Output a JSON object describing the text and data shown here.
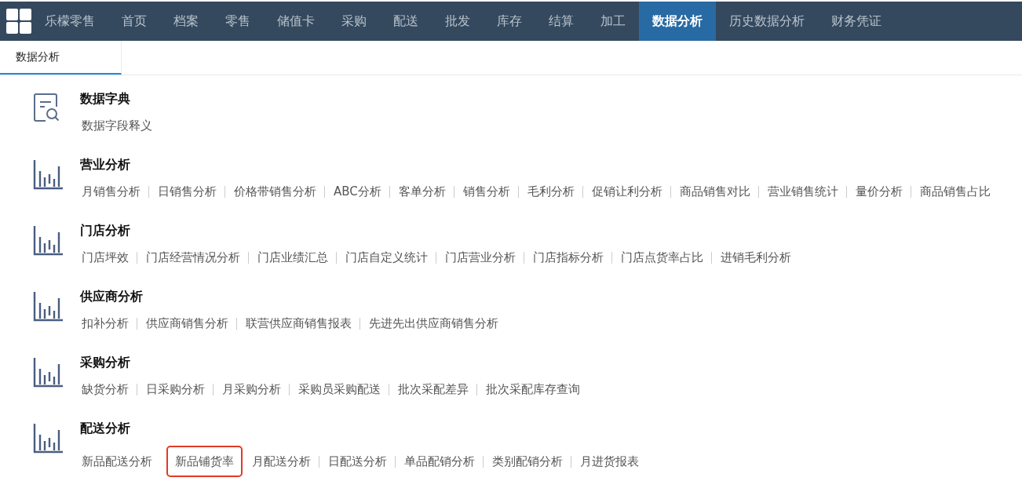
{
  "nav": {
    "brand": "乐檬零售",
    "items": [
      {
        "label": "首页",
        "selected": false
      },
      {
        "label": "档案",
        "selected": false
      },
      {
        "label": "零售",
        "selected": false
      },
      {
        "label": "储值卡",
        "selected": false
      },
      {
        "label": "采购",
        "selected": false
      },
      {
        "label": "配送",
        "selected": false
      },
      {
        "label": "批发",
        "selected": false
      },
      {
        "label": "库存",
        "selected": false
      },
      {
        "label": "结算",
        "selected": false
      },
      {
        "label": "加工",
        "selected": false
      },
      {
        "label": "数据分析",
        "selected": true
      },
      {
        "label": "历史数据分析",
        "selected": false
      },
      {
        "label": "财务凭证",
        "selected": false
      }
    ]
  },
  "tabs": [
    {
      "label": "数据分析",
      "selected": true
    }
  ],
  "sections": [
    {
      "kind": "dictionary",
      "title": "数据字典",
      "links": [
        {
          "label": "数据字段释义",
          "highlighted": false
        }
      ]
    },
    {
      "kind": "chart",
      "title": "营业分析",
      "links": [
        {
          "label": "月销售分析",
          "highlighted": false
        },
        {
          "label": "日销售分析",
          "highlighted": false
        },
        {
          "label": "价格带销售分析",
          "highlighted": false
        },
        {
          "label": "ABC分析",
          "highlighted": false
        },
        {
          "label": "客单分析",
          "highlighted": false
        },
        {
          "label": "销售分析",
          "highlighted": false
        },
        {
          "label": "毛利分析",
          "highlighted": false
        },
        {
          "label": "促销让利分析",
          "highlighted": false
        },
        {
          "label": "商品销售对比",
          "highlighted": false
        },
        {
          "label": "营业销售统计",
          "highlighted": false
        },
        {
          "label": "量价分析",
          "highlighted": false
        },
        {
          "label": "商品销售占比",
          "highlighted": false
        }
      ]
    },
    {
      "kind": "chart",
      "title": "门店分析",
      "links": [
        {
          "label": "门店坪效",
          "highlighted": false
        },
        {
          "label": "门店经营情况分析",
          "highlighted": false
        },
        {
          "label": "门店业绩汇总",
          "highlighted": false
        },
        {
          "label": "门店自定义统计",
          "highlighted": false
        },
        {
          "label": "门店营业分析",
          "highlighted": false
        },
        {
          "label": "门店指标分析",
          "highlighted": false
        },
        {
          "label": "门店点货率占比",
          "highlighted": false
        },
        {
          "label": "进销毛利分析",
          "highlighted": false
        }
      ]
    },
    {
      "kind": "chart",
      "title": "供应商分析",
      "links": [
        {
          "label": "扣补分析",
          "highlighted": false
        },
        {
          "label": "供应商销售分析",
          "highlighted": false
        },
        {
          "label": "联营供应商销售报表",
          "highlighted": false
        },
        {
          "label": "先进先出供应商销售分析",
          "highlighted": false
        }
      ]
    },
    {
      "kind": "chart",
      "title": "采购分析",
      "links": [
        {
          "label": "缺货分析",
          "highlighted": false
        },
        {
          "label": "日采购分析",
          "highlighted": false
        },
        {
          "label": "月采购分析",
          "highlighted": false
        },
        {
          "label": "采购员采购配送",
          "highlighted": false
        },
        {
          "label": "批次采配差异",
          "highlighted": false
        },
        {
          "label": "批次采配库存查询",
          "highlighted": false
        }
      ]
    },
    {
      "kind": "chart",
      "title": "配送分析",
      "links": [
        {
          "label": "新品配送分析",
          "highlighted": false
        },
        {
          "label": "新品铺货率",
          "highlighted": true
        },
        {
          "label": "月配送分析",
          "highlighted": false
        },
        {
          "label": "日配送分析",
          "highlighted": false
        },
        {
          "label": "单品配销分析",
          "highlighted": false
        },
        {
          "label": "类别配销分析",
          "highlighted": false
        },
        {
          "label": "月进货报表",
          "highlighted": false
        }
      ]
    }
  ]
}
